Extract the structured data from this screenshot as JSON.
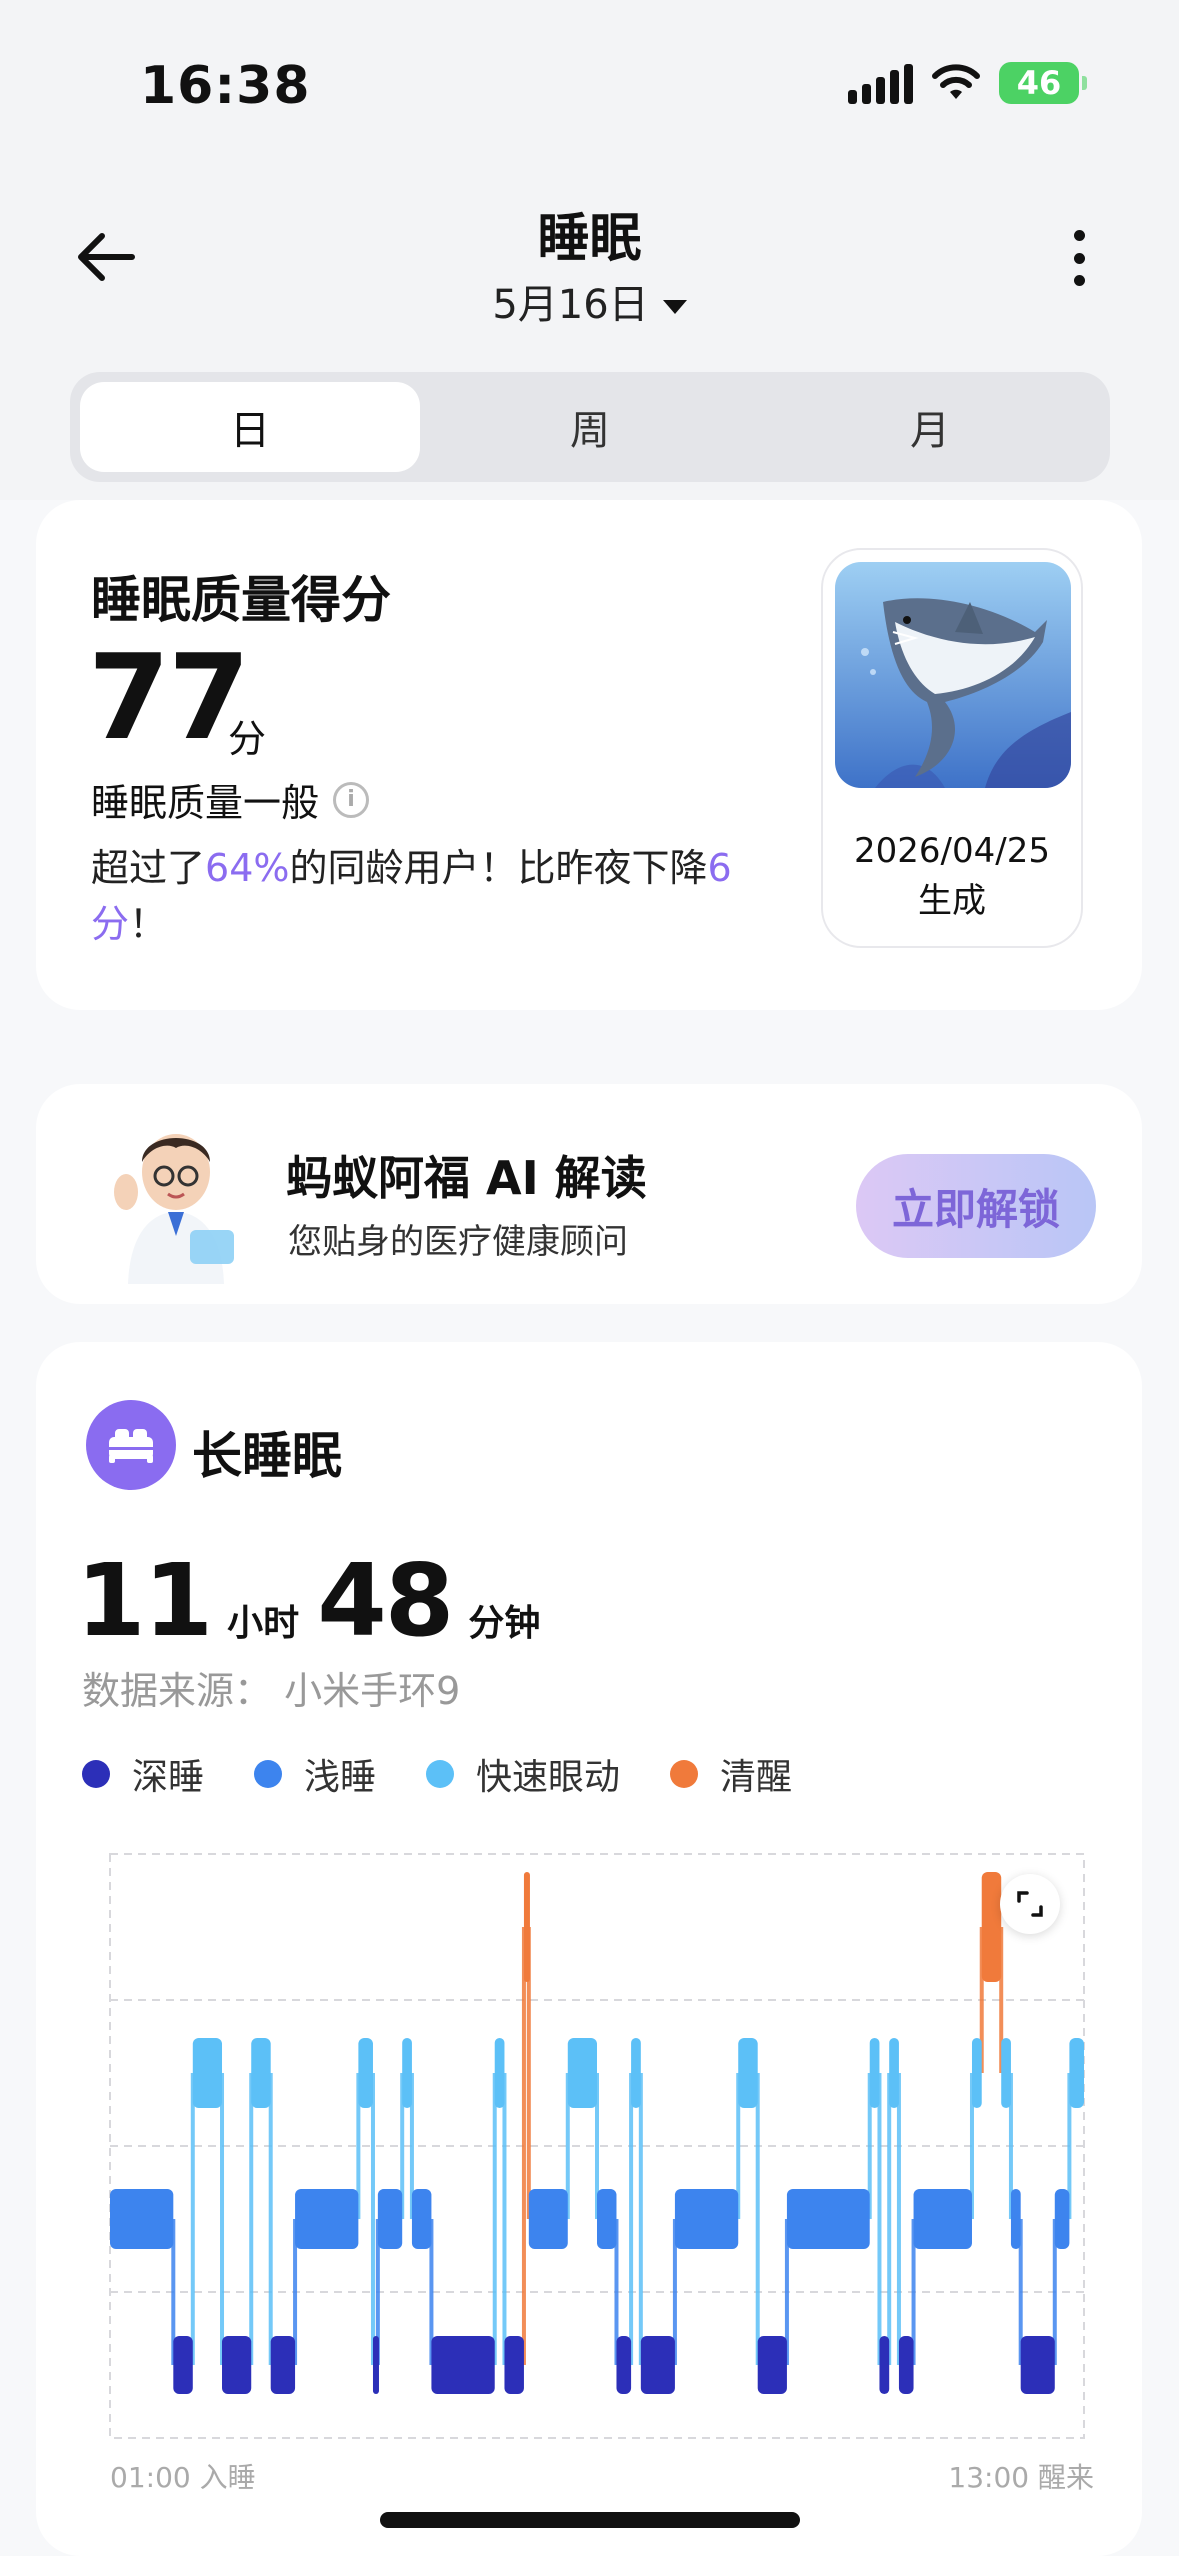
{
  "status_bar": {
    "time": "16:38",
    "battery": "46"
  },
  "header": {
    "title": "睡眠",
    "date": "5月16日"
  },
  "tabs": [
    {
      "label": "日",
      "active": true
    },
    {
      "label": "周",
      "active": false
    },
    {
      "label": "月",
      "active": false
    }
  ],
  "score_card": {
    "title": "睡眠质量得分",
    "score": "77",
    "unit": "分",
    "level": "睡眠质量一般",
    "desc_prefix": "超过了",
    "percent": "64%",
    "desc_middle": "的同龄用户！比昨夜下降",
    "drop": "6分",
    "desc_suffix": "！",
    "image_date": "2026/04/25",
    "image_caption": "生成"
  },
  "ai_card": {
    "title": "蚂蚁阿福 AI 解读",
    "subtitle": "您贴身的医疗健康顾问",
    "button": "立即解锁"
  },
  "sleep_card": {
    "title": "长睡眠",
    "hours": "11",
    "hours_unit": "小时",
    "minutes": "48",
    "minutes_unit": "分钟",
    "source": "数据来源： 小米手环9",
    "legend": [
      {
        "label": "深睡",
        "color": "#2c2fb8"
      },
      {
        "label": "浅睡",
        "color": "#3d84ee"
      },
      {
        "label": "快速眼动",
        "color": "#5cc0f7"
      },
      {
        "label": "清醒",
        "color": "#f07a3b"
      }
    ],
    "start_label": "01:00 入睡",
    "end_label": "13:00 醒来"
  },
  "chart_data": {
    "type": "area",
    "stages": [
      "清醒",
      "快速眼动",
      "浅睡",
      "深睡"
    ],
    "x_start": "01:00",
    "x_end": "13:00",
    "segments": [
      {
        "stage": "浅睡",
        "start": 0.0,
        "end": 0.065
      },
      {
        "stage": "深睡",
        "start": 0.065,
        "end": 0.085
      },
      {
        "stage": "快速眼动",
        "start": 0.085,
        "end": 0.115
      },
      {
        "stage": "深睡",
        "start": 0.115,
        "end": 0.145
      },
      {
        "stage": "快速眼动",
        "start": 0.145,
        "end": 0.165
      },
      {
        "stage": "深睡",
        "start": 0.165,
        "end": 0.19
      },
      {
        "stage": "浅睡",
        "start": 0.19,
        "end": 0.255
      },
      {
        "stage": "快速眼动",
        "start": 0.255,
        "end": 0.27
      },
      {
        "stage": "深睡",
        "start": 0.27,
        "end": 0.275
      },
      {
        "stage": "浅睡",
        "start": 0.275,
        "end": 0.3
      },
      {
        "stage": "快速眼动",
        "start": 0.3,
        "end": 0.31
      },
      {
        "stage": "浅睡",
        "start": 0.31,
        "end": 0.33
      },
      {
        "stage": "深睡",
        "start": 0.33,
        "end": 0.395
      },
      {
        "stage": "快速眼动",
        "start": 0.395,
        "end": 0.405
      },
      {
        "stage": "深睡",
        "start": 0.405,
        "end": 0.425
      },
      {
        "stage": "清醒",
        "start": 0.425,
        "end": 0.43
      },
      {
        "stage": "浅睡",
        "start": 0.43,
        "end": 0.47
      },
      {
        "stage": "快速眼动",
        "start": 0.47,
        "end": 0.5
      },
      {
        "stage": "浅睡",
        "start": 0.5,
        "end": 0.52
      },
      {
        "stage": "深睡",
        "start": 0.52,
        "end": 0.535
      },
      {
        "stage": "快速眼动",
        "start": 0.535,
        "end": 0.545
      },
      {
        "stage": "深睡",
        "start": 0.545,
        "end": 0.58
      },
      {
        "stage": "浅睡",
        "start": 0.58,
        "end": 0.645
      },
      {
        "stage": "快速眼动",
        "start": 0.645,
        "end": 0.665
      },
      {
        "stage": "深睡",
        "start": 0.665,
        "end": 0.695
      },
      {
        "stage": "浅睡",
        "start": 0.695,
        "end": 0.78
      },
      {
        "stage": "快速眼动",
        "start": 0.78,
        "end": 0.79
      },
      {
        "stage": "深睡",
        "start": 0.79,
        "end": 0.8
      },
      {
        "stage": "快速眼动",
        "start": 0.8,
        "end": 0.81
      },
      {
        "stage": "深睡",
        "start": 0.81,
        "end": 0.825
      },
      {
        "stage": "浅睡",
        "start": 0.825,
        "end": 0.885
      },
      {
        "stage": "快速眼动",
        "start": 0.885,
        "end": 0.895
      },
      {
        "stage": "清醒",
        "start": 0.895,
        "end": 0.915
      },
      {
        "stage": "快速眼动",
        "start": 0.915,
        "end": 0.925
      },
      {
        "stage": "浅睡",
        "start": 0.925,
        "end": 0.935
      },
      {
        "stage": "深睡",
        "start": 0.935,
        "end": 0.97
      },
      {
        "stage": "浅睡",
        "start": 0.97,
        "end": 0.985
      },
      {
        "stage": "快速眼动",
        "start": 0.985,
        "end": 1.0
      }
    ]
  }
}
